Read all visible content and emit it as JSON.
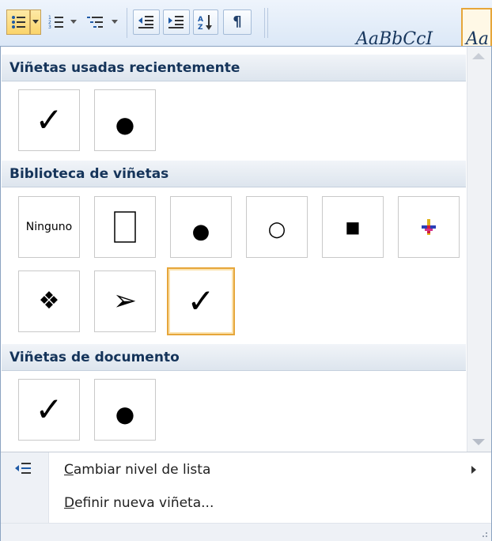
{
  "ribbon": {
    "style_preview_1": "AaBbCcI",
    "style_preview_2": "Aa",
    "icons": [
      "bullets-icon",
      "dropdown-icon",
      "numbering-icon",
      "multilevel-list-icon",
      "decrease-indent-icon",
      "increase-indent-icon",
      "sort-icon",
      "pilcrow-icon"
    ]
  },
  "panel": {
    "recent": {
      "title": "Viñetas usadas recientemente",
      "items": [
        "✓",
        "●"
      ]
    },
    "library": {
      "title": "Biblioteca de viñetas",
      "row1": [
        "Ninguno",
        "□",
        "●",
        "○",
        "■",
        "⯌"
      ],
      "row2": [
        "❖",
        "➢",
        "✓"
      ],
      "selected_index": 2
    },
    "document": {
      "title": "Viñetas de documento",
      "items": [
        "✓",
        "●"
      ]
    }
  },
  "menu": {
    "change_level": {
      "accel": "C",
      "label_rest": "ambiar nivel de lista"
    },
    "define_new": {
      "accel": "D",
      "label_rest": "efinir nueva viñeta..."
    }
  },
  "colors": {
    "header_text": "#15345a",
    "selection_border": "#e6a63a",
    "ribbon_bg": "#d9e6f6"
  }
}
